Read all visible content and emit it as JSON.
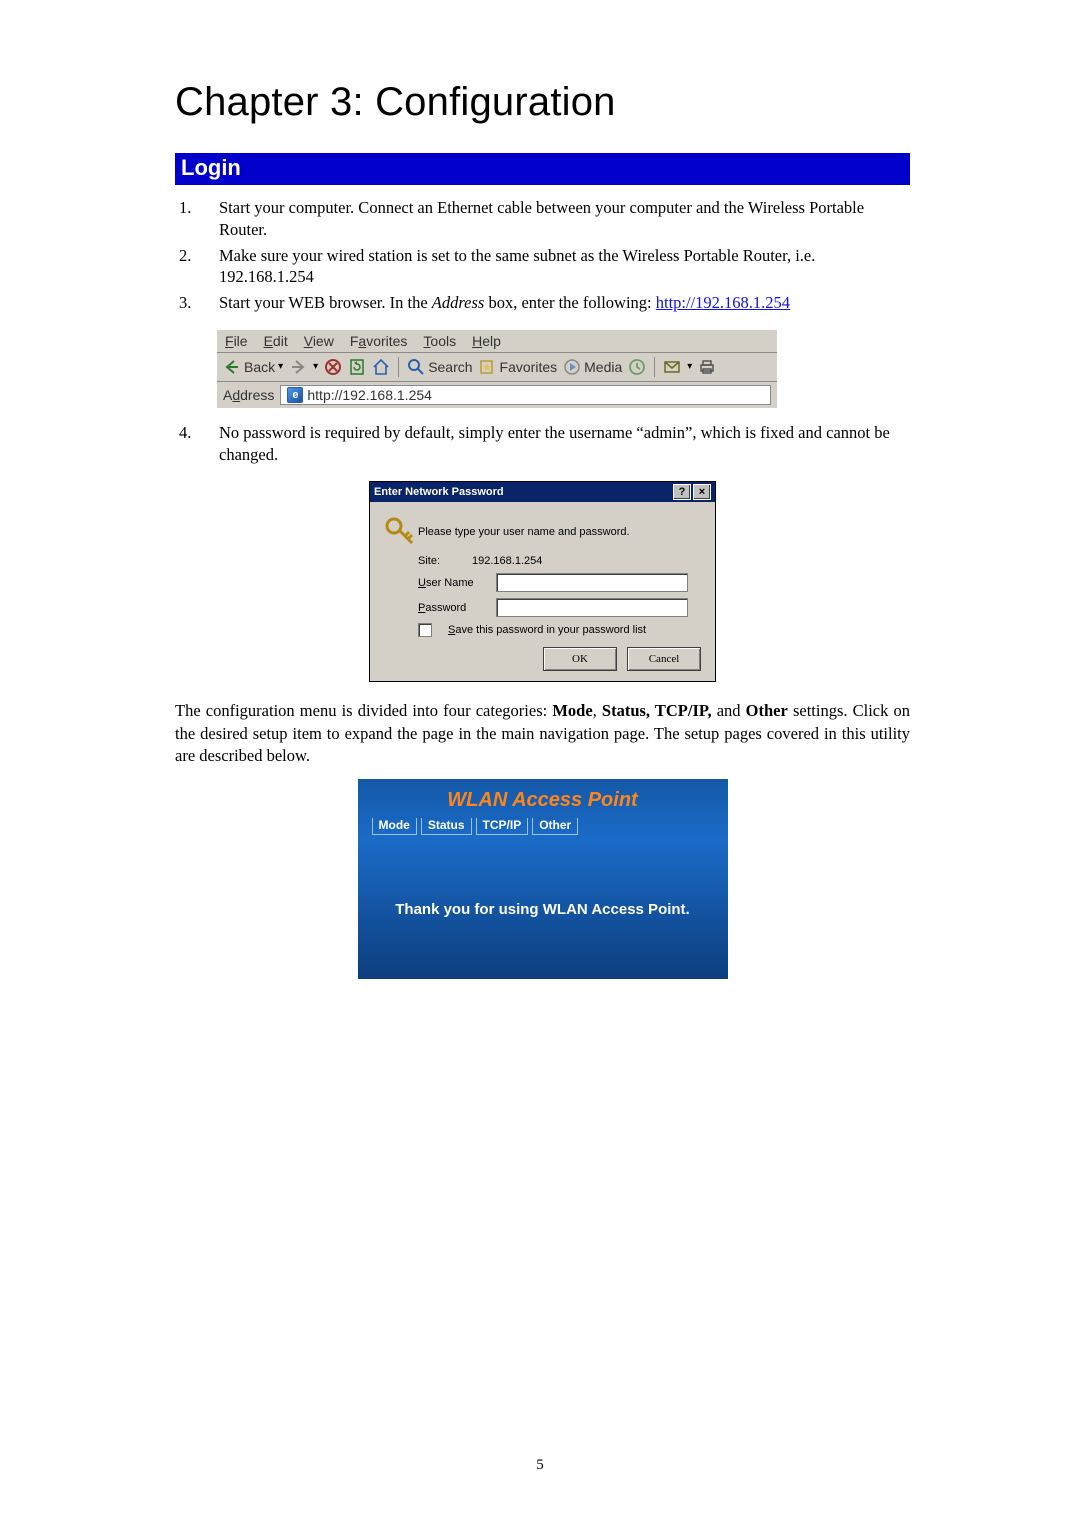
{
  "chapter_title": "Chapter 3: Configuration",
  "section_heading": "Login",
  "steps": {
    "s1_num": "1.",
    "s1": "Start your computer. Connect an Ethernet cable between your computer and the Wireless Portable Router.",
    "s2_num": "2.",
    "s2": "Make sure your wired station is set to the same subnet as the Wireless Portable Router, i.e. 192.168.1.254",
    "s3_num": "3.",
    "s3_a": "Start your WEB browser. In the ",
    "s3_i": "Address",
    "s3_b": " box, enter the following: ",
    "s3_link": "http://192.168.1.254",
    "s4_num": "4.",
    "s4": "No password is required by default, simply enter the username “admin”, which is fixed and cannot be changed."
  },
  "ie": {
    "menu": {
      "file": "File",
      "edit": "Edit",
      "view": "View",
      "favorites": "Favorites",
      "tools": "Tools",
      "help": "Help"
    },
    "back": "Back",
    "search": "Search",
    "favorites_btn": "Favorites",
    "media": "Media",
    "address_label": "Address",
    "address_value": "http://192.168.1.254"
  },
  "np": {
    "title": "Enter Network Password",
    "prompt": "Please type your user name and password.",
    "site_label": "Site:",
    "site_value": "192.168.1.254",
    "user_u": "U",
    "user_rest": "ser Name",
    "pass_u": "P",
    "pass_rest": "assword",
    "save_u": "S",
    "save_rest": "ave this password in your password list",
    "ok": "OK",
    "cancel": "Cancel"
  },
  "post_para_a": "The configuration menu is divided into four categories: ",
  "post_para_b1": "Mode",
  "post_para_sep1": ", ",
  "post_para_b2": "Status, TCP/IP,",
  "post_para_sep2": " and ",
  "post_para_b3": "Other",
  "post_para_c": " settings.  Click on the desired setup item to expand the page in the main navigation page. The setup pages covered in this utility are described below.",
  "wlan": {
    "title": "WLAN Access Point",
    "tabs": {
      "mode": "Mode",
      "status": "Status",
      "tcpip": "TCP/IP",
      "other": "Other"
    },
    "msg": "Thank you for using WLAN Access Point."
  },
  "page_number": "5"
}
